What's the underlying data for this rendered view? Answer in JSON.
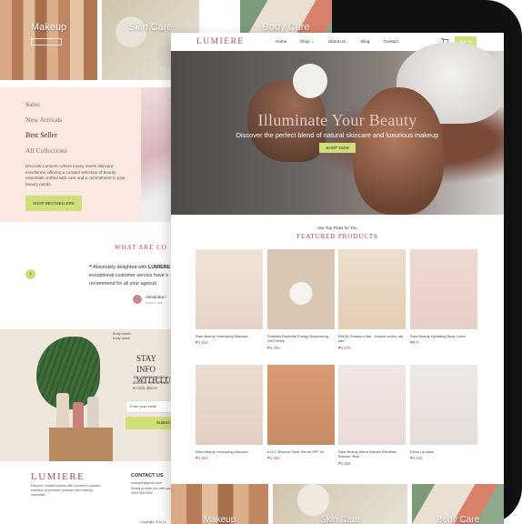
{
  "brand": "LUMIERE",
  "back_page": {
    "categories": [
      {
        "label": "Makeup"
      },
      {
        "label": "Skin Care"
      },
      {
        "label": "Body Care"
      }
    ],
    "sidebar": {
      "menu": [
        "Sales",
        "New Arrivals",
        "Best Seller",
        "All Collections"
      ],
      "active": "Best Seller",
      "description": "Discover Lumiere, where luxury meets skincare excellence, offering a curated selection of beauty essentials crafted with care and a commitment to your beauty needs.",
      "button": "SHOP BESTSELLERS"
    },
    "testimonials": {
      "heading": "WHAT ARE CO",
      "quote_prefix": "Absolutely delighted with",
      "quote_brand": "LUMIERE",
      "quote_rest": "exceptional customer service have s recommend for all your agricult",
      "name": "Alexandra l",
      "role": "Home Cook"
    },
    "promo": {
      "tag": "Body wash body wash",
      "heading_1": "STAY INFO",
      "heading_2": "WITH LU",
      "sub": "Join now to receive p discover new arrivals, an only discou",
      "email_placeholder": "Enter your email",
      "subscribe": "SUBSCR"
    },
    "footer": {
      "logo": "LUMIERE",
      "description": "Discover curated brands with Lumiere's curated selection of premium skincare and makeup essentials.",
      "contact_heading": "CONTACT US",
      "contact_lines": [
        "example@gmail.com",
        "Ready provide you with you",
        "0000 000 0000"
      ],
      "copyright": "Copyright 2024 | L"
    }
  },
  "front_page": {
    "nav": {
      "logo": "LUMIERE",
      "items": [
        "Home",
        "Shop",
        "About Us",
        "Blog",
        "Contact"
      ],
      "shop_chevron": "⌄",
      "signup": "Sign up"
    },
    "hero": {
      "title": "Illuminate Your Beauty",
      "subtitle": "Discover the perfect blend of natural skincare and luxurious makeup",
      "button": "SHOP NOW"
    },
    "featured": {
      "kicker": "Our Top Picks for You",
      "heading": "FEATURED PRODUCTS",
      "products": [
        {
          "name": "Rare Beauty Volumizing Mascara",
          "price": "₱1,915"
        },
        {
          "name": "Shiseido Essential Energy Moisturizing Gel Cream",
          "price": "₱1,750"
        },
        {
          "name": "BKIND Shampoo bar - Normal and/or oily hair",
          "price": "₱1,570"
        },
        {
          "name": "Rare Beauty Hydrating Body Lotion",
          "price": "₱877"
        },
        {
          "name": "Rare Beauty Volumizing Mascara",
          "price": "₱1,915"
        },
        {
          "name": "ILIA C Beyond Triple Serum SPF 40",
          "price": "₱1,500"
        },
        {
          "name": "Rare Beauty Warm Wishes Effortless Bronzer Stick",
          "price": "₱1,564"
        },
        {
          "name": "Ethos Lip Balm",
          "price": "₱1,915"
        }
      ]
    },
    "bottom_tiles": [
      {
        "label": "Makeup"
      },
      {
        "label": "Skin Care"
      },
      {
        "label": "Body Care"
      }
    ]
  },
  "colors": {
    "accent": "#b0485a",
    "button": "#cfe07a",
    "panel": "#fbe9e1"
  }
}
